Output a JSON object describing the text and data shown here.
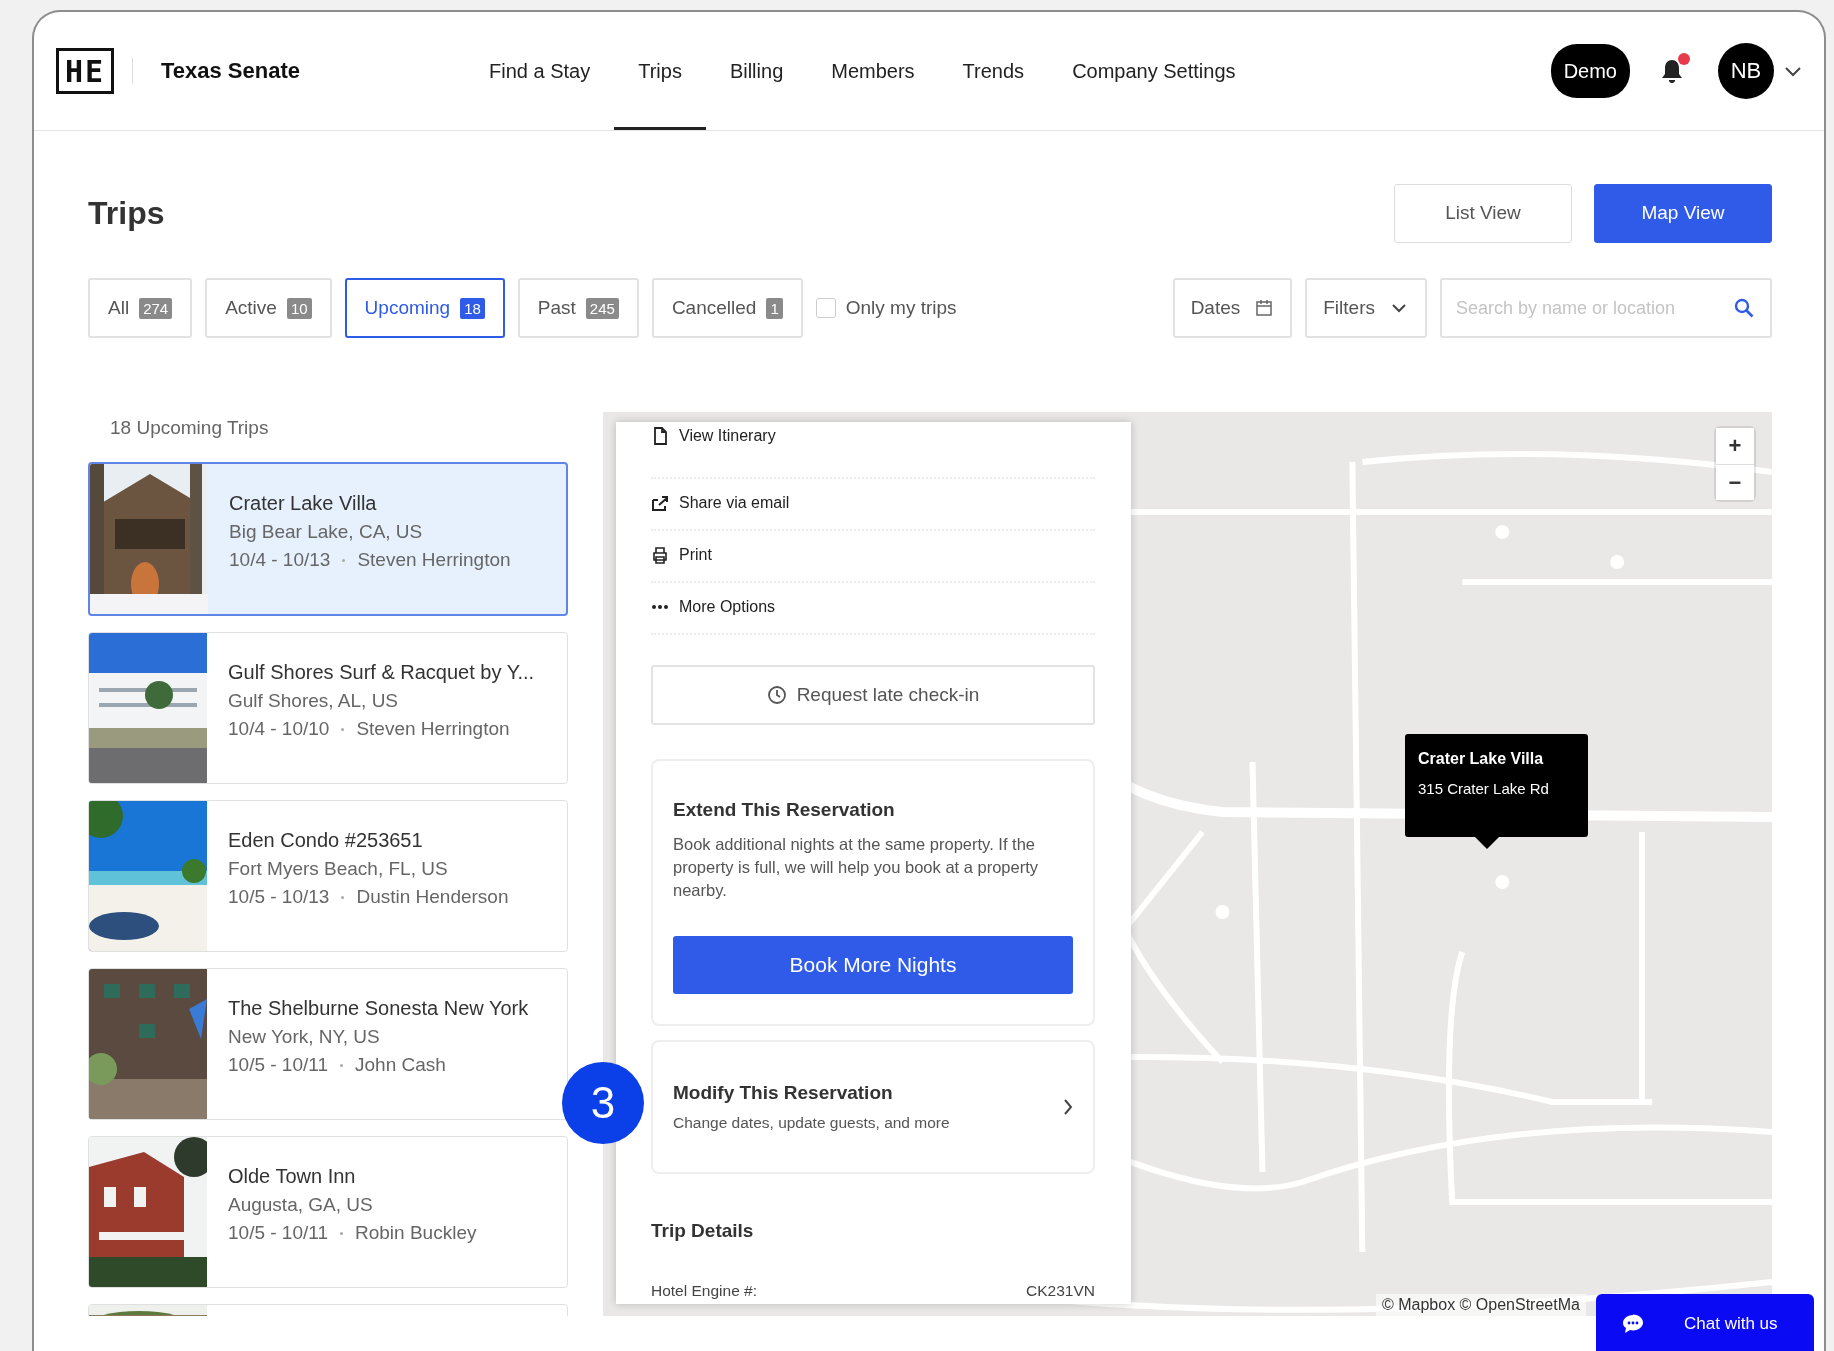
{
  "header": {
    "logo": "HE",
    "org": "Texas Senate",
    "nav": [
      {
        "label": "Find a Stay",
        "selected": false
      },
      {
        "label": "Trips",
        "selected": true
      },
      {
        "label": "Billing",
        "selected": false
      },
      {
        "label": "Members",
        "selected": false
      },
      {
        "label": "Trends",
        "selected": false
      },
      {
        "label": "Company Settings",
        "selected": false
      }
    ],
    "demo": "Demo",
    "notifications": {
      "unread": true
    },
    "avatar": "NB"
  },
  "page": {
    "title": "Trips",
    "views": [
      {
        "label": "List View",
        "selected": false
      },
      {
        "label": "Map View",
        "selected": true
      }
    ]
  },
  "filters": {
    "tabs": [
      {
        "label": "All",
        "count": "274",
        "selected": false
      },
      {
        "label": "Active",
        "count": "10",
        "selected": false
      },
      {
        "label": "Upcoming",
        "count": "18",
        "selected": true
      },
      {
        "label": "Past",
        "count": "245",
        "selected": false
      },
      {
        "label": "Cancelled",
        "count": "1",
        "selected": false
      }
    ],
    "only_mine": {
      "label": "Only my trips",
      "checked": false
    },
    "dates": "Dates",
    "filters": "Filters",
    "search": {
      "placeholder": "Search by name or location"
    }
  },
  "trips": {
    "heading": "18 Upcoming Trips",
    "items": [
      {
        "name": "Crater Lake Villa",
        "location": "Big Bear Lake, CA, US",
        "dates": "10/4 - 10/13",
        "guest": "Steven Herrington",
        "selected": true
      },
      {
        "name": "Gulf Shores Surf & Racquet by Y...",
        "location": "Gulf Shores, AL, US",
        "dates": "10/4 - 10/10",
        "guest": "Steven Herrington",
        "selected": false
      },
      {
        "name": "Eden Condo #253651",
        "location": "Fort Myers Beach, FL, US",
        "dates": "10/5 - 10/13",
        "guest": "Dustin Henderson",
        "selected": false
      },
      {
        "name": "The Shelburne Sonesta New York",
        "location": "New York, NY, US",
        "dates": "10/5 - 10/11",
        "guest": "John Cash",
        "selected": false
      },
      {
        "name": "Olde Town Inn",
        "location": "Augusta, GA, US",
        "dates": "10/5 - 10/11",
        "guest": "Robin Buckley",
        "selected": false
      }
    ]
  },
  "trip_panel": {
    "actions": [
      "View Itinerary",
      "Share via email",
      "Print",
      "More Options"
    ],
    "late_checkin": "Request late check-in",
    "extend": {
      "title": "Extend This Reservation",
      "text": "Book additional nights at the same property. If the property is full, we will help you book at a property nearby.",
      "button": "Book More Nights"
    },
    "modify": {
      "title": "Modify This Reservation",
      "text": "Change dates, update guests, and more"
    },
    "details": {
      "title": "Trip Details",
      "rows": [
        {
          "label": "Hotel Engine #:",
          "value": "CK231VN"
        }
      ]
    }
  },
  "map": {
    "tooltip": {
      "title": "Crater Lake Villa",
      "address": "315 Crater Lake Rd"
    },
    "zoom": [
      "+",
      "−"
    ],
    "attribution": "© Mapbox © OpenStreetMa"
  },
  "step_badge": "3",
  "chat": "Chat with us"
}
